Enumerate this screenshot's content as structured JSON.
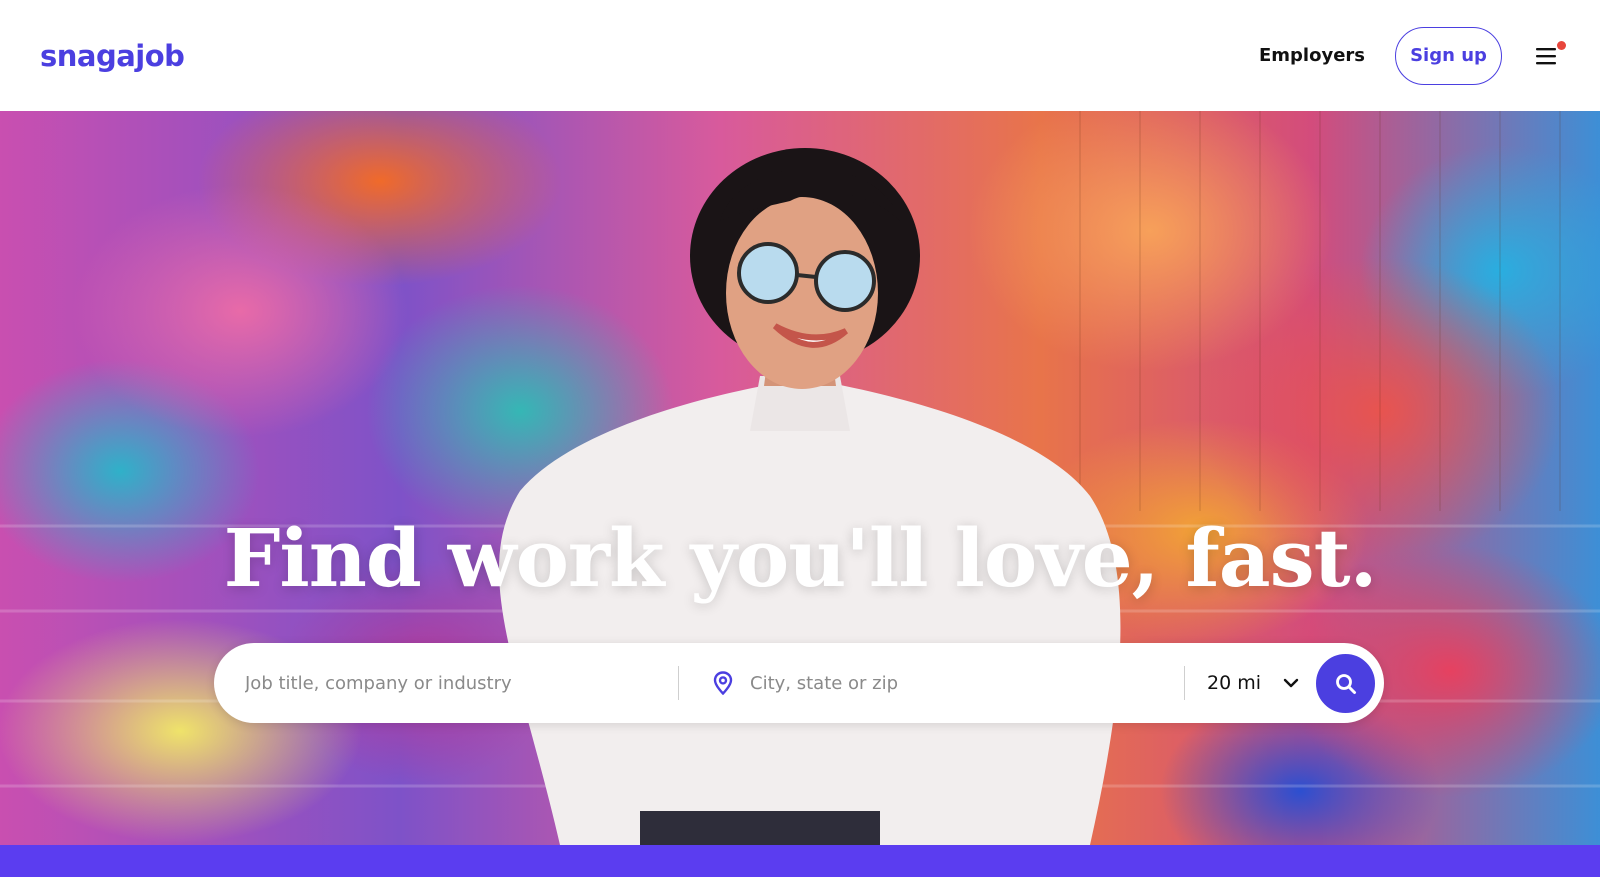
{
  "header": {
    "logo_text": "snagajob",
    "employers_label": "Employers",
    "signup_label": "Sign up",
    "menu_icon": "hamburger-menu-icon",
    "notification_dot_color": "#e8463c"
  },
  "hero": {
    "headline": "Find work you'll love, fast."
  },
  "search": {
    "job_placeholder": "Job title, company or industry",
    "job_value": "",
    "location_placeholder": "City, state or zip",
    "location_value": "",
    "location_icon": "location-pin-icon",
    "radius_value": "20 mi",
    "radius_icon": "chevron-down-icon",
    "search_icon": "search-icon"
  },
  "colors": {
    "brand": "#4b3fe0",
    "bottom_band": "#5b3df0"
  }
}
